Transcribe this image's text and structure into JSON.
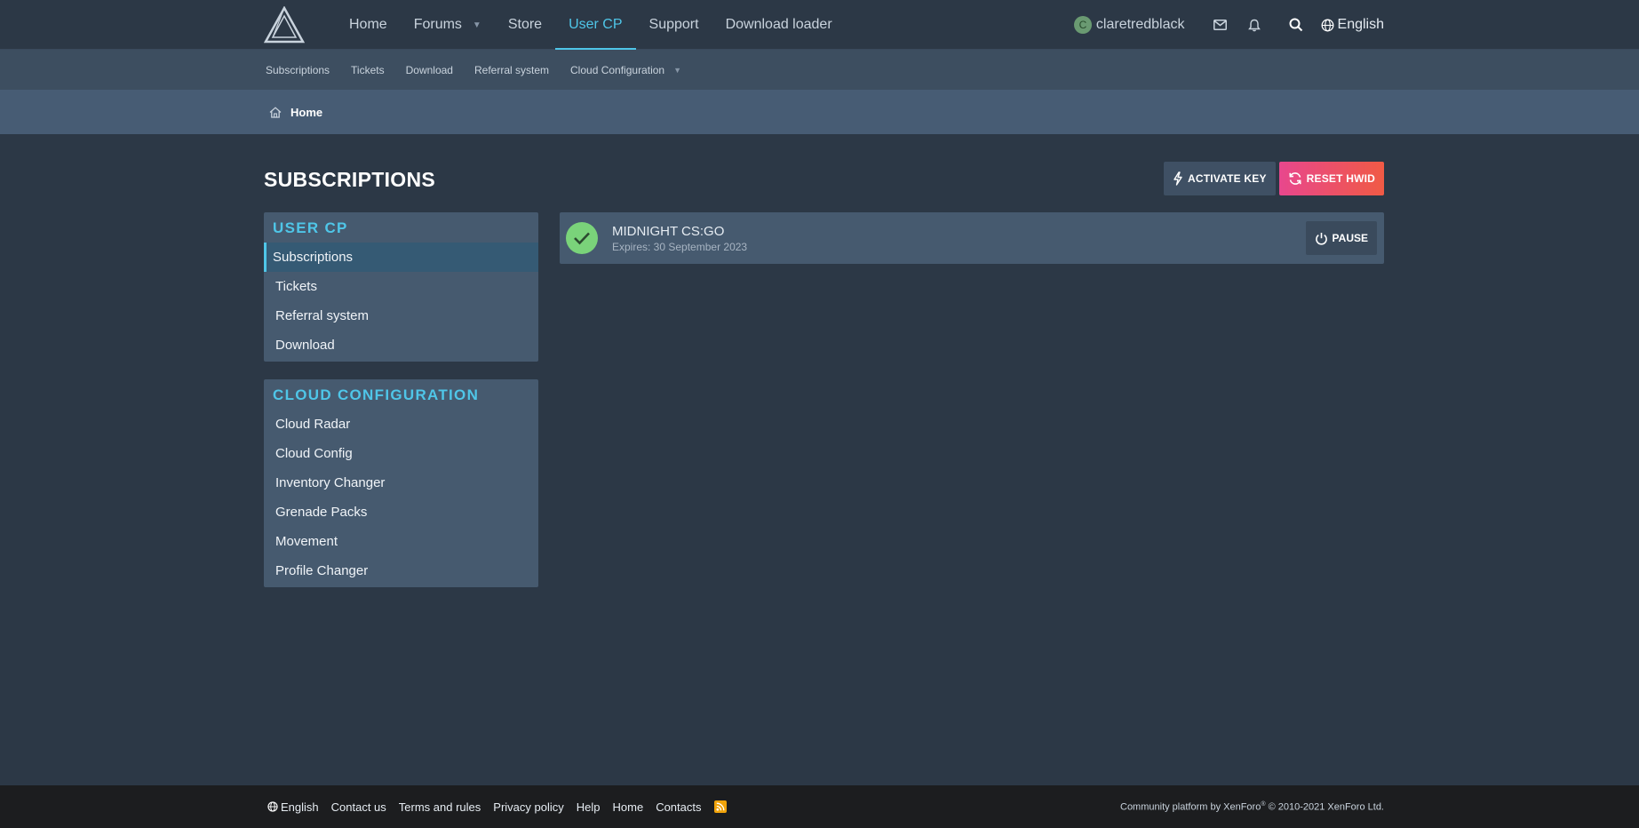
{
  "topnav": {
    "tabs": [
      {
        "label": "Home"
      },
      {
        "label": "Forums"
      },
      {
        "label": "Store"
      },
      {
        "label": "User CP"
      },
      {
        "label": "Support"
      },
      {
        "label": "Download loader"
      }
    ],
    "user": {
      "initial": "C",
      "name": "claretredblack"
    },
    "language": "English"
  },
  "subnav": {
    "items": [
      "Subscriptions",
      "Tickets",
      "Download",
      "Referral system",
      "Cloud Configuration"
    ]
  },
  "breadcrumb": {
    "home": "Home"
  },
  "page": {
    "title": "SUBSCRIPTIONS",
    "activate_key": "ACTIVATE KEY",
    "reset_hwid": "RESET HWID"
  },
  "sidebar": {
    "usercp": {
      "title": "USER CP",
      "items": [
        "Subscriptions",
        "Tickets",
        "Referral system",
        "Download"
      ]
    },
    "cloud": {
      "title": "CLOUD CONFIGURATION",
      "items": [
        "Cloud Radar",
        "Cloud Config",
        "Inventory Changer",
        "Grenade Packs",
        "Movement",
        "Profile Changer"
      ]
    }
  },
  "subscription": {
    "name": "MIDNIGHT CS:GO",
    "expires": "Expires: 30 September 2023",
    "pause": "PAUSE"
  },
  "footer": {
    "links": [
      "English",
      "Contact us",
      "Terms and rules",
      "Privacy policy",
      "Help",
      "Home",
      "Contacts"
    ],
    "copyright_prefix": "Community platform by XenForo",
    "copyright_reg": "®",
    "copyright_suffix": " © 2010-2021 XenForo Ltd."
  },
  "colors": {
    "accent": "#4fc6e8",
    "background": "#2c3846",
    "panel": "#465a6f",
    "reset_gradient_start": "#e8478d",
    "reset_gradient_end": "#f05a45",
    "status_active": "#7ad37a"
  },
  "icons": {
    "logo": "triangle-logo-icon",
    "mail": "envelope-icon",
    "alerts": "bell-icon",
    "search": "search-icon",
    "language": "globe-icon",
    "home": "home-icon",
    "activate": "bolt-icon",
    "reset": "refresh-icon",
    "status": "check-icon",
    "pause": "power-icon",
    "rss": "rss-icon"
  }
}
